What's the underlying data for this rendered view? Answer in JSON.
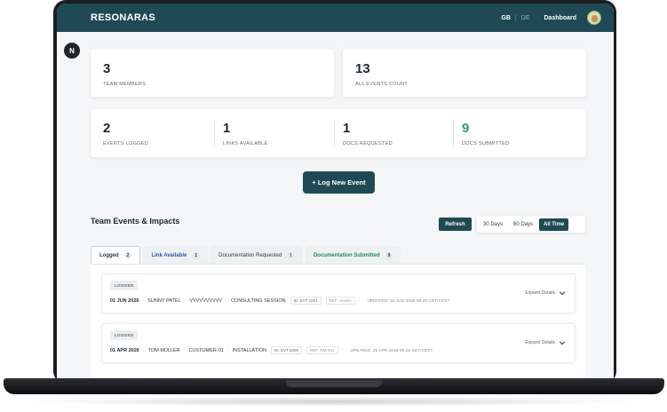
{
  "header": {
    "brand": "RESONARAS",
    "lang_active": "GB",
    "lang_separator": "|",
    "lang_other": "DE",
    "nav_dashboard": "Dashboard"
  },
  "floating_badge": "N",
  "stats_top": [
    {
      "value": "3",
      "label": "TEAM MEMBERS"
    },
    {
      "value": "13",
      "label": "ALL EVENTS COUNT"
    }
  ],
  "stats_bottom": [
    {
      "value": "2",
      "label": "EVENTS LOGGED"
    },
    {
      "value": "1",
      "label": "LINKS AVAILABLE"
    },
    {
      "value": "1",
      "label": "DOCS REQUESTED"
    },
    {
      "value": "9",
      "label": "DOCS SUBMITTED"
    }
  ],
  "log_button": "+ Log New Event",
  "section_title": "Team Events & Impacts",
  "controls": {
    "refresh": "Refresh",
    "ranges": [
      "30 Days",
      "60 Days",
      "All Time"
    ],
    "active_range": "All Time"
  },
  "tabs": [
    {
      "label": "Logged",
      "count": "2"
    },
    {
      "label": "Link Available",
      "count": "1"
    },
    {
      "label": "Documentation Requested",
      "count": "1"
    },
    {
      "label": "Documentation Submitted",
      "count": "9"
    }
  ],
  "events": [
    {
      "status": "LOGGED",
      "date": "01 JUN 2026",
      "person": "SUNNY PATEL",
      "customer": "VVVVVVVVVV",
      "type": "CONSULTING SESSION",
      "id": "ID: EVT-1021",
      "ref": "REF: vvvvvv",
      "updated": "UPDATED: 16 JUN 2026 08:29 CET/CEST",
      "expand": "Expand Details"
    },
    {
      "status": "LOGGED",
      "date": "01 APR 2026",
      "person": "TOM MÜLLER",
      "customer": "CUSTOMER-01",
      "type": "INSTALLATION",
      "id": "ID: EVT-1000",
      "ref": "REF: RM-001",
      "updated": "UPDATED: 29 APR 2026 08:26 CET/CEST",
      "expand": "Expand Details"
    }
  ],
  "colors": {
    "brand_teal": "#1f4a55",
    "success_green": "#27a36a",
    "link_blue": "#2a57a8"
  }
}
